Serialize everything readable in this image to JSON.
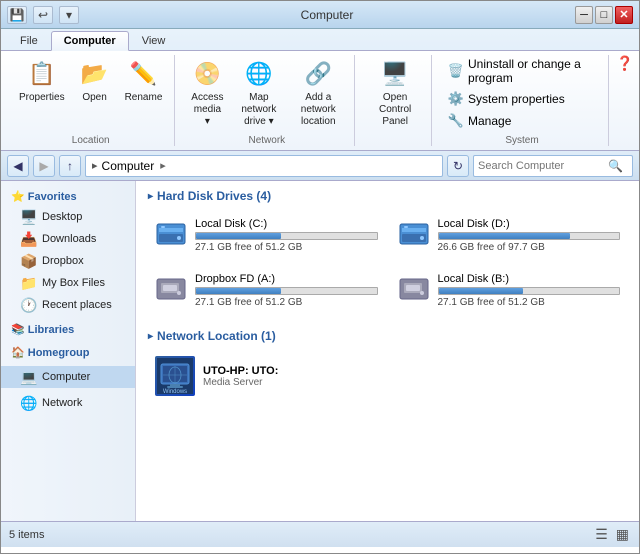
{
  "window": {
    "title": "Computer",
    "quick_access_btns": [
      "💾",
      "↩",
      "▾"
    ]
  },
  "ribbon": {
    "tabs": [
      {
        "label": "File",
        "active": false
      },
      {
        "label": "Computer",
        "active": true
      },
      {
        "label": "View",
        "active": false
      }
    ],
    "groups": {
      "location": {
        "label": "Location",
        "buttons": [
          {
            "label": "Properties",
            "icon": "📋"
          },
          {
            "label": "Open",
            "icon": "📂"
          },
          {
            "label": "Rename",
            "icon": "✏️"
          }
        ]
      },
      "network": {
        "label": "Network",
        "buttons": [
          {
            "label": "Access\nmedia ▾",
            "icon": "📀"
          },
          {
            "label": "Map network\ndrive ▾",
            "icon": "🌐"
          },
          {
            "label": "Add a network\nlocation",
            "icon": "🔗"
          }
        ]
      },
      "control": {
        "label": "",
        "buttons": [
          {
            "label": "Open Control\nPanel",
            "icon": "🖥️"
          }
        ]
      },
      "system": {
        "label": "System",
        "items": [
          {
            "label": "Uninstall or change a program",
            "icon": "🗑️"
          },
          {
            "label": "System properties",
            "icon": "⚙️"
          },
          {
            "label": "Manage",
            "icon": "🔧"
          }
        ]
      }
    }
  },
  "nav": {
    "back_disabled": false,
    "forward_disabled": true,
    "up_disabled": false,
    "path_parts": [
      "Computer"
    ],
    "search_placeholder": "Search Computer"
  },
  "sidebar": {
    "sections": [
      {
        "name": "Favorites",
        "icon": "⭐",
        "items": [
          {
            "label": "Desktop",
            "icon": "🖥️"
          },
          {
            "label": "Downloads",
            "icon": "📥"
          },
          {
            "label": "Dropbox",
            "icon": "📦"
          },
          {
            "label": "My Box Files",
            "icon": "📁"
          },
          {
            "label": "Recent places",
            "icon": "🕐"
          }
        ]
      },
      {
        "name": "Libraries",
        "icon": "📚",
        "items": []
      },
      {
        "name": "Homegroup",
        "icon": "🏠",
        "items": []
      },
      {
        "name": "Computer",
        "icon": "💻",
        "active": true,
        "items": []
      },
      {
        "name": "Network",
        "icon": "🌐",
        "items": []
      }
    ]
  },
  "content": {
    "hard_disk_section": "Hard Disk Drives (4)",
    "drives": [
      {
        "name": "Local Disk (C:)",
        "free": "27.1 GB free of 51.2 GB",
        "used_pct": 47,
        "icon": "💿",
        "low": false
      },
      {
        "name": "Local Disk (D:)",
        "free": "26.6 GB free of 97.7 GB",
        "used_pct": 73,
        "icon": "💿",
        "low": false
      },
      {
        "name": "Dropbox FD (A:)",
        "free": "27.1 GB free of 51.2 GB",
        "used_pct": 47,
        "icon": "💽",
        "low": false
      },
      {
        "name": "Local Disk (B:)",
        "free": "27.1 GB free of 51.2 GB",
        "used_pct": 47,
        "icon": "💽",
        "low": false
      }
    ],
    "network_section": "Network Location (1)",
    "network_items": [
      {
        "name": "UTO-HP: UTO:",
        "desc": "Media Server",
        "icon": "▶"
      }
    ]
  },
  "status": {
    "items_count": "5 items"
  }
}
